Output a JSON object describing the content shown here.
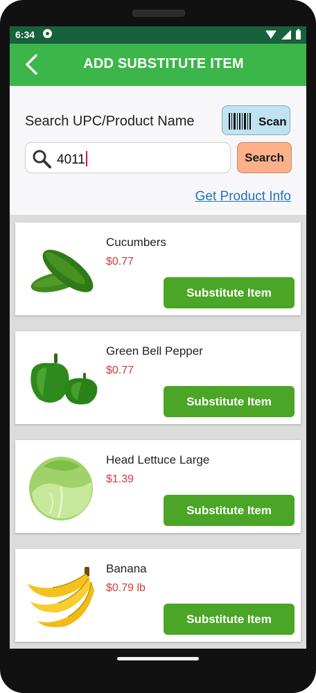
{
  "status_bar": {
    "time": "6:34"
  },
  "app_bar": {
    "title": "ADD SUBSTITUTE ITEM",
    "back_icon": "chevron-left-icon"
  },
  "search": {
    "label": "Search UPC/Product Name",
    "scan_label": "Scan",
    "input_value": "4011",
    "search_label": "Search",
    "info_link": "Get Product Info"
  },
  "colors": {
    "status_bar": "#17613c",
    "app_bar": "#3cb54a",
    "substitute_button": "#4ba527",
    "search_button": "#fbb08a",
    "scan_button": "#bfe3f1",
    "price": "#d23b3b",
    "link": "#1f73b6"
  },
  "products": [
    {
      "name": "Cucumbers",
      "price": "$0.77",
      "button": "Substitute Item",
      "image": "cucumber-image"
    },
    {
      "name": "Green Bell Pepper",
      "price": "$0.77",
      "button": "Substitute Item",
      "image": "green-bell-pepper-image"
    },
    {
      "name": "Head Lettuce Large",
      "price": "$1.39",
      "button": "Substitute Item",
      "image": "lettuce-image"
    },
    {
      "name": "Banana",
      "price": "$0.79 lb",
      "button": "Substitute Item",
      "image": "banana-image"
    }
  ]
}
